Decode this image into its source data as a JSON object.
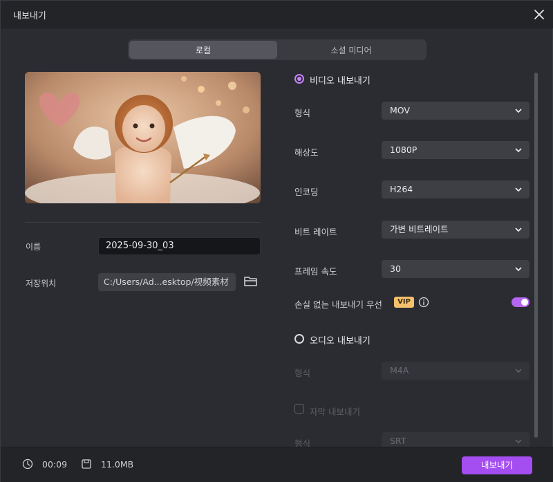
{
  "window": {
    "title": "내보내기"
  },
  "tabs": [
    {
      "label": "로컬",
      "active": true
    },
    {
      "label": "소셜 미디어",
      "active": false
    }
  ],
  "left": {
    "name_label": "이름",
    "name_value": "2025-09-30_03",
    "location_label": "저장위치",
    "location_value": "C:/Users/Ad...esktop/视频素材"
  },
  "video": {
    "title": "비디오 내보내기",
    "selected": true,
    "rows": [
      {
        "label": "형식",
        "value": "MOV"
      },
      {
        "label": "해상도",
        "value": "1080P"
      },
      {
        "label": "인코딩",
        "value": "H264"
      },
      {
        "label": "비트 레이트",
        "value": "가변 비트레이트"
      },
      {
        "label": "프레임 속도",
        "value": "30"
      }
    ],
    "lossless_label": "손실 없는 내보내기 우선",
    "vip_badge": "VIP",
    "lossless_enabled": true
  },
  "audio": {
    "title": "오디오 내보내기",
    "selected": false,
    "format_label": "형식",
    "format_value": "M4A"
  },
  "subtitle": {
    "title": "자막 내보내기",
    "checked": false,
    "format_label": "형식",
    "format_value": "SRT"
  },
  "footer": {
    "duration": "00:09",
    "size": "11.0MB",
    "export_label": "내보내기"
  },
  "colors": {
    "accent": "#a44df0",
    "radio": "#c783ff",
    "vip": "#f5c16c"
  }
}
